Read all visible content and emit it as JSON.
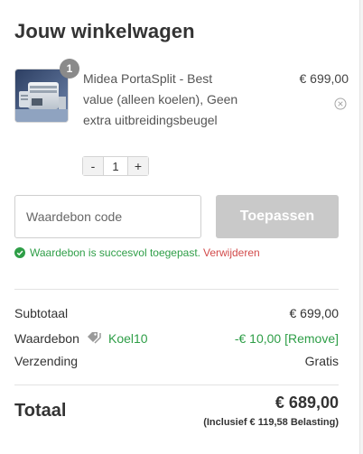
{
  "cart": {
    "title": "Jouw winkelwagen",
    "item": {
      "quantity_badge": "1",
      "name": "Midea PortaSplit - Best value (alleen koelen), Geen extra uitbreidingsbeugel",
      "price": "€ 699,00",
      "stepper": {
        "minus": "-",
        "value": "1",
        "plus": "+"
      },
      "image_icon": "air-conditioner-product-image",
      "remove_icon": "circle-x-icon"
    }
  },
  "voucher": {
    "placeholder": "Waardebon code",
    "apply_label": "Toepassen",
    "success_message": "Waardebon is succesvol toegepast.",
    "remove_link": "Verwijderen",
    "success_color": "#2e9e47",
    "remove_color": "#d24b4b"
  },
  "summary": {
    "subtotal_label": "Subtotaal",
    "subtotal_value": "€ 699,00",
    "voucher_label": "Waardebon",
    "voucher_code": "Koel10",
    "voucher_value": "-€ 10,00 [Remove]",
    "shipping_label": "Verzending",
    "shipping_value": "Gratis",
    "total_label": "Totaal",
    "total_value": "€ 689,00",
    "tax_note": "(Inclusief € 119,58 Belasting)"
  }
}
